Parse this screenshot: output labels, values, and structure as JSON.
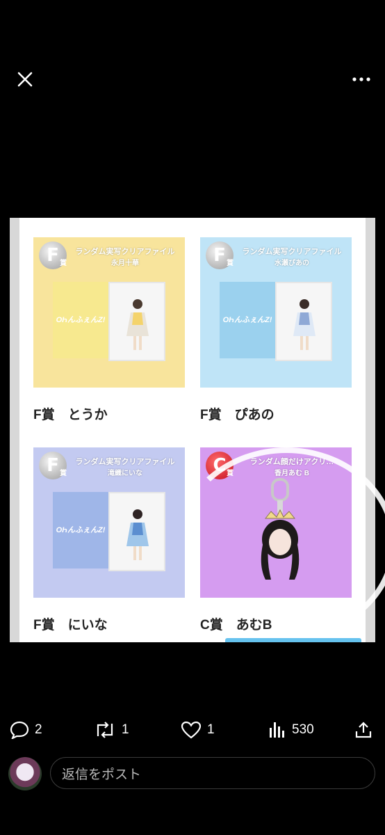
{
  "viewer": {
    "close_icon": "close-icon",
    "more_icon": "more-icon"
  },
  "cards": [
    {
      "badge": "F",
      "badge_sub": "賞",
      "title": "ランダム実写クリアファイル",
      "subtitle": "永月十華",
      "logo": "ОҺんふぇんΖ!",
      "caption": "F賞　とうか"
    },
    {
      "badge": "F",
      "badge_sub": "賞",
      "title": "ランダム実写クリアファイル",
      "subtitle": "水瀬ぴあの",
      "logo": "ОҺんふぇんΖ!",
      "caption": "F賞　ぴあの"
    },
    {
      "badge": "F",
      "badge_sub": "賞",
      "title": "ランダム実写クリアファイル",
      "subtitle": "滝織にいな",
      "logo": "ОҺんふぇんΖ!",
      "caption": "F賞　にいな"
    },
    {
      "badge": "C",
      "badge_sub": "賞",
      "title": "ランダム顔だけアクリ…",
      "subtitle": "香月あむ B",
      "caption": "C賞　あむB"
    }
  ],
  "actions": {
    "replies": "2",
    "reposts": "1",
    "likes": "1",
    "views": "530"
  },
  "reply": {
    "placeholder": "返信をポスト"
  }
}
